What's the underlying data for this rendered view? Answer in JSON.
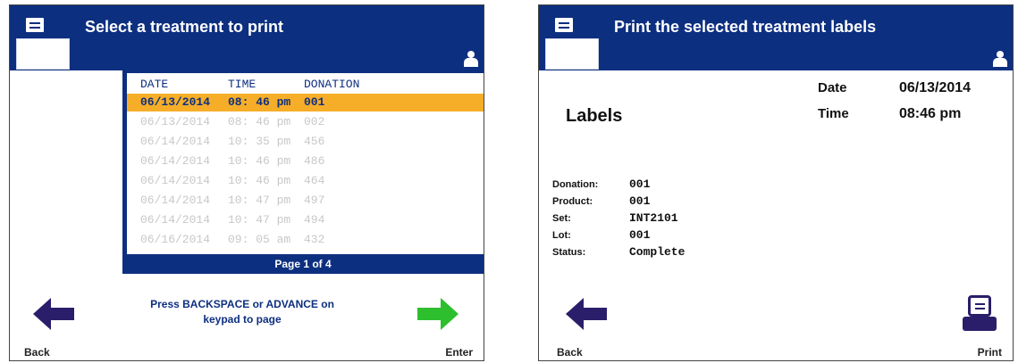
{
  "left": {
    "title": "Select a treatment to print",
    "table": {
      "headers": {
        "date": "DATE",
        "time": "TIME",
        "donation": "DONATION"
      },
      "rows": [
        {
          "date": "06/13/2014",
          "time": "08: 46 pm",
          "donation": "001"
        },
        {
          "date": "06/13/2014",
          "time": "08: 46 pm",
          "donation": "002"
        },
        {
          "date": "06/14/2014",
          "time": "10: 35 pm",
          "donation": "456"
        },
        {
          "date": "06/14/2014",
          "time": "10: 46 pm",
          "donation": "486"
        },
        {
          "date": "06/14/2014",
          "time": "10: 46 pm",
          "donation": "464"
        },
        {
          "date": "06/14/2014",
          "time": "10: 47 pm",
          "donation": "497"
        },
        {
          "date": "06/14/2014",
          "time": "10: 47 pm",
          "donation": "494"
        },
        {
          "date": "06/16/2014",
          "time": "09: 05 am",
          "donation": "432"
        }
      ],
      "page_label": "Page 1 of 4"
    },
    "help_line1": "Press BACKSPACE or ADVANCE on",
    "help_line2": "keypad to page",
    "back_label": "Back",
    "enter_label": "Enter"
  },
  "right": {
    "title": "Print the selected treatment labels",
    "labels_heading": "Labels",
    "date_label": "Date",
    "date_value": "06/13/2014",
    "time_label": "Time",
    "time_value": "08:46 pm",
    "details": [
      {
        "label": "Donation:",
        "value": "001"
      },
      {
        "label": "Product:",
        "value": "001"
      },
      {
        "label": "Set:",
        "value": "INT2101"
      },
      {
        "label": "Lot:",
        "value": "001"
      },
      {
        "label": "Status:",
        "value": "Complete"
      }
    ],
    "back_label": "Back",
    "print_label": "Print"
  },
  "colors": {
    "header": "#0d2f80",
    "selected_row": "#f6ae28",
    "back_arrow": "#2a1e6b",
    "enter_arrow": "#2dbf2d"
  },
  "icons": [
    "printer-icon",
    "user-icon",
    "back-arrow-icon",
    "enter-arrow-icon",
    "print-icon"
  ]
}
